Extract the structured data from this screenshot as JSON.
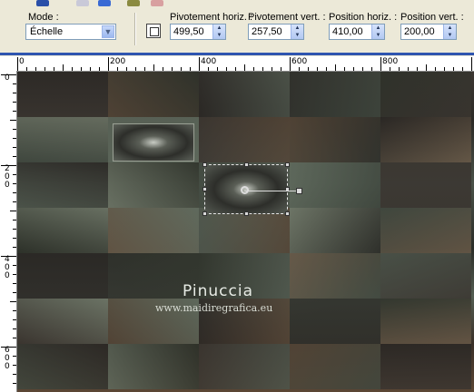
{
  "toolbar": {
    "mode_label": "Mode :",
    "mode_value": "Échelle",
    "pivot_h_label": "Pivotement horiz. :",
    "pivot_h_value": "499,50",
    "pivot_v_label": "Pivotement vert. :",
    "pivot_v_value": "257,50",
    "pos_h_label": "Position horiz. :",
    "pos_h_value": "410,00",
    "pos_v_label": "Position vert. :",
    "pos_v_value": "200,00"
  },
  "ruler_top": [
    "0",
    "200",
    "400",
    "600",
    "800"
  ],
  "ruler_left": [
    [
      "0"
    ],
    [
      "2",
      "0",
      "0"
    ],
    [
      "4",
      "0",
      "0"
    ],
    [
      "6",
      "0",
      "0"
    ]
  ],
  "canvas": {
    "watermark_name": "Pinuccia",
    "watermark_url": "www.maidiregrafica.eu"
  },
  "icons": {
    "top_strip": [
      "toolbar-icon-1",
      "toolbar-icon-2",
      "toolbar-icon-3",
      "toolbar-icon-4",
      "toolbar-icon-5"
    ],
    "tool": "deform-tool-icon"
  },
  "colors": {
    "accent_blue": "#2f55b0",
    "toolbar_bg": "#ece9d8"
  }
}
